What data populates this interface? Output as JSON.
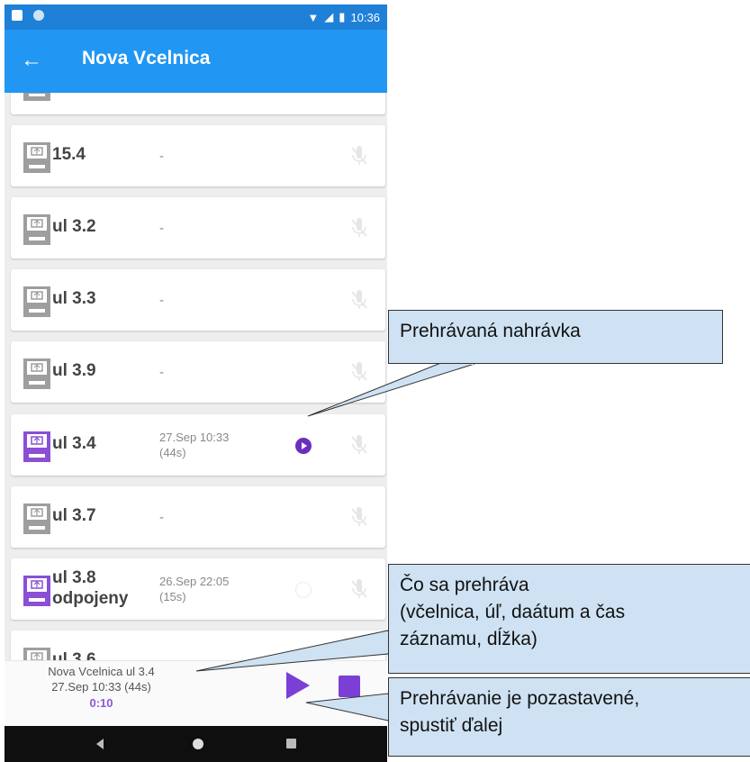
{
  "status_bar": {
    "time": "10:36"
  },
  "app_bar": {
    "back_icon": "arrow-left-icon",
    "title": "Nova Vcelnica"
  },
  "hives": [
    {
      "name": "",
      "date": "",
      "active": false,
      "partial": true
    },
    {
      "name": "15.4",
      "date": "-",
      "active": false
    },
    {
      "name": "ul 3.2",
      "date": "-",
      "active": false
    },
    {
      "name": "ul 3.3",
      "date": "-",
      "active": false
    },
    {
      "name": "ul 3.9",
      "date": "-",
      "active": false
    },
    {
      "name": "ul 3.4",
      "date_line1": "27.Sep 10:33",
      "date_line2": "(44s)",
      "active": true,
      "playing": true
    },
    {
      "name": "ul 3.7",
      "date": "-",
      "active": false
    },
    {
      "name_line1": "ul 3.8",
      "name_line2": "odpojeny",
      "date_line1": "26.Sep 22:05",
      "date_line2": "(15s)",
      "active": true,
      "playing": false
    },
    {
      "name": "ul 3.6",
      "date": "-",
      "active": false
    }
  ],
  "player": {
    "line1": "Nova Vcelnica ul 3.4",
    "line2": "27.Sep 10:33 (44s)",
    "time": "0:10",
    "accent": "#7b3fd6"
  },
  "callouts": {
    "playing": "Prehrávaná nahrávka",
    "what_line1": "Čo sa prehráva",
    "what_line2": "(včelnica, úľ, daátum a čas",
    "what_line3": "záznamu, dĺžka)",
    "paused_line1": "Prehrávanie je pozastavené,",
    "paused_line2": "spustiť ďalej"
  },
  "colors": {
    "app_bar": "#2196f3",
    "status_bar": "#1f80d8",
    "active_icon": "#8a4fd6",
    "inactive_icon": "#9e9e9e",
    "callout_fill": "#cfe2f3"
  }
}
